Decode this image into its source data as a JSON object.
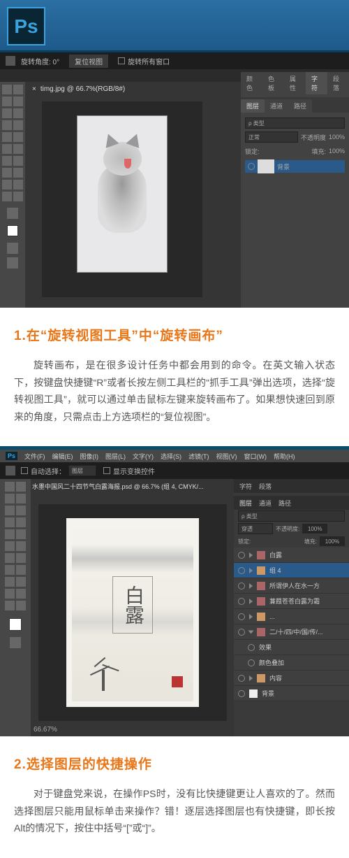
{
  "logo": "Ps",
  "screenshot1": {
    "topbar": {
      "angle_label": "旋转角度: 0°",
      "reset_view": "复位视图",
      "rotate_all": "旋转所有窗口"
    },
    "tab": "timg.jpg @ 66.7%(RGB/8#)",
    "close": "×",
    "panels": {
      "tab_color": "颜色",
      "tab_swatch": "色板",
      "tab_props": "属性",
      "tab_char": "字符",
      "tab_para": "段落",
      "tab_layers": "图层",
      "tab_channels": "通道",
      "tab_paths": "路径",
      "kind": "ρ 类型",
      "blend": "正常",
      "opacity_label": "不透明度",
      "opacity": "100%",
      "lock_label": "锁定:",
      "fill_label": "填充:",
      "fill": "100%",
      "layer_bg": "背景"
    }
  },
  "section1": {
    "title": "1.在“旋转视图工具”中“旋转画布”",
    "body": "旋转画布，是在很多设计任务中都会用到的命令。在英文输入状态下，按键盘快捷键“R”或者长按左侧工具栏的“抓手工具”弹出选项，选择“旋转视图工具”，就可以通过单击鼠标左键来旋转画布了。如果想快速回到原来的角度，只需点击上方选项栏的“复位视图”。"
  },
  "screenshot2": {
    "menu_ps": "Ps",
    "menu": {
      "file": "文件(F)",
      "edit": "编辑(E)",
      "image": "图像(I)",
      "layer": "图层(L)",
      "type": "文字(Y)",
      "select": "选择(S)",
      "filter": "滤镜(T)",
      "view": "视图(V)",
      "window": "窗口(W)",
      "help": "帮助(H)"
    },
    "opt1": "自动选择：",
    "opt2": "图层",
    "opt3": "显示变换控件",
    "tab": "水墨中国风二十四节气白露海报.psd @ 66.7% (组 4, CMYK/...",
    "poster_title": "白露",
    "zoom": "66.67%",
    "panels": {
      "h_char": "字符",
      "h_para": "段落",
      "t_layers": "图层",
      "t_channels": "通道",
      "t_paths": "路径",
      "kind": "ρ 类型",
      "blend": "穿透",
      "opacity_label": "不透明度:",
      "opacity": "100%",
      "lock": "锁定:",
      "fill_label": "填充:",
      "fill": "100%",
      "l1": "白露",
      "l2": "组 4",
      "l3": "所谓伊人在水一方",
      "l4": "蒹葭苍苍白露为霜",
      "l5": "...",
      "l6": "二/十/四/中/国/传/...",
      "l7": "效果",
      "l8": "颜色叠加",
      "l9": "内容",
      "l10": "背景"
    }
  },
  "section2": {
    "title": "2.选择图层的快捷操作",
    "body": "对于键盘党来说，在操作PS时，没有比快捷键更让人喜欢的了。然而选择图层只能用鼠标单击来操作？错！逐层选择图层也有快捷键，即长按Alt的情况下，按住中括号“[”或“]”。"
  }
}
